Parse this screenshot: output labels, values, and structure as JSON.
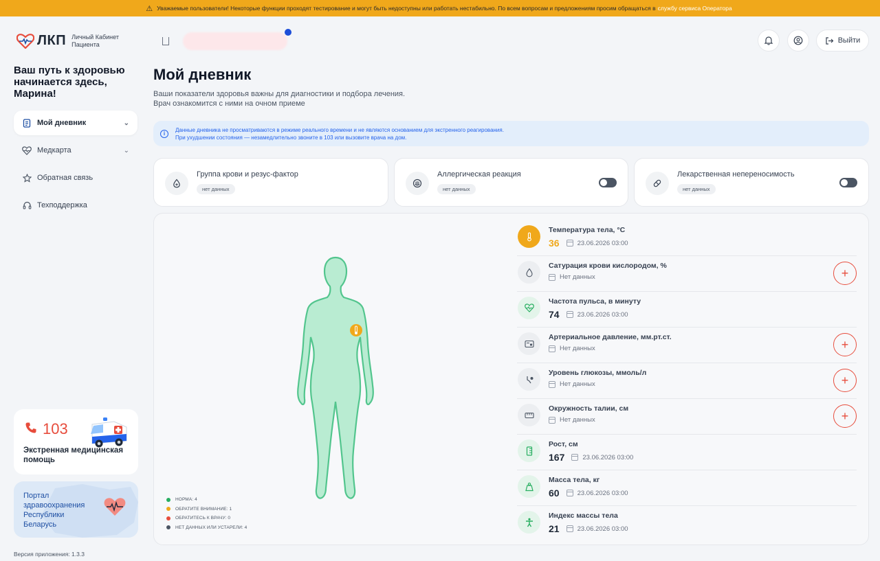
{
  "banner": {
    "text": "Уважаемые пользователи! Некоторые функции проходят тестирование и могут быть недоступны или работать нестабильно. По всем вопросам и предложениям просим обращаться в",
    "link": "службу сервиса Оператора"
  },
  "logo": {
    "name": "ЛКП",
    "subtitle": "Личный Кабинет Пациента"
  },
  "greeting": "Ваш путь к здоровью начинается здесь, Марина!",
  "nav": [
    {
      "label": "Мой дневник",
      "active": true,
      "chevron": true
    },
    {
      "label": "Медкарта",
      "active": false,
      "chevron": true
    },
    {
      "label": "Обратная связь",
      "active": false,
      "chevron": false
    },
    {
      "label": "Техподдержка",
      "active": false,
      "chevron": false
    }
  ],
  "emergency": {
    "number": "103",
    "label": "Экстренная медицинская помощь"
  },
  "portal": {
    "label": "Портал здравоохранения Республики Беларусь"
  },
  "version": "Версия приложения: 1.3.3",
  "header": {
    "logout_label": "Выйти"
  },
  "page": {
    "title": "Мой дневник",
    "description_line1": "Ваши показатели здоровья важны для диагностики и подбора лечения.",
    "description_line2": "Врач ознакомится с ними на очном приеме"
  },
  "info": {
    "line1": "Данные дневника не просматриваются в режиме реального времени и не являются основанием для экстренного реагирования.",
    "line2": "При ухудшении состояния — незамедлительно звоните в 103 или вызовите врача на дом."
  },
  "cards": [
    {
      "title": "Группа крови и резус-фактор",
      "badge": "нет данных",
      "toggle": false,
      "icon": "blood-drop-icon"
    },
    {
      "title": "Аллергическая реакция",
      "badge": "нет данных",
      "toggle": true,
      "icon": "allergy-icon"
    },
    {
      "title": "Лекарственная непереносимость",
      "badge": "нет данных",
      "toggle": true,
      "icon": "pill-icon"
    }
  ],
  "legend": [
    {
      "label": "НОРМА: 4",
      "color": "#27ae60"
    },
    {
      "label": "ОБРАТИТЕ ВНИМАНИЕ: 1",
      "color": "#f0a81b"
    },
    {
      "label": "ОБРАТИТЕСЬ К ВРАЧУ: 0",
      "color": "#e74c3c"
    },
    {
      "label": "НЕТ ДАННЫХ ИЛИ УСТАРЕЛИ: 4",
      "color": "#4b5563"
    }
  ],
  "metrics": [
    {
      "title": "Температура тела, °C",
      "value": "36",
      "date": "23.06.2026 03:00",
      "status": "warn",
      "add": false,
      "icon": "thermometer-icon"
    },
    {
      "title": "Сатурация крови кислородом, %",
      "value": "",
      "date": "Нет данных",
      "status": "none",
      "add": true,
      "icon": "drop-icon"
    },
    {
      "title": "Частота пульса, в минуту",
      "value": "74",
      "date": "23.06.2026 03:00",
      "status": "ok",
      "add": false,
      "icon": "heart-pulse-icon"
    },
    {
      "title": "Артериальное давление, мм.рт.ст.",
      "value": "",
      "date": "Нет данных",
      "status": "none",
      "add": true,
      "icon": "tonometer-icon"
    },
    {
      "title": "Уровень глюкозы, ммоль/л",
      "value": "",
      "date": "Нет данных",
      "status": "none",
      "add": true,
      "icon": "glucose-icon"
    },
    {
      "title": "Окружность талии, см",
      "value": "",
      "date": "Нет данных",
      "status": "none",
      "add": true,
      "icon": "tape-icon"
    },
    {
      "title": "Рост, см",
      "value": "167",
      "date": "23.06.2026 03:00",
      "status": "ok",
      "add": false,
      "icon": "ruler-icon"
    },
    {
      "title": "Масса тела, кг",
      "value": "60",
      "date": "23.06.2026 03:00",
      "status": "ok",
      "add": false,
      "icon": "weight-icon"
    },
    {
      "title": "Индекс массы тела",
      "value": "21",
      "date": "23.06.2026 03:00",
      "status": "ok",
      "add": false,
      "icon": "body-index-icon"
    }
  ]
}
